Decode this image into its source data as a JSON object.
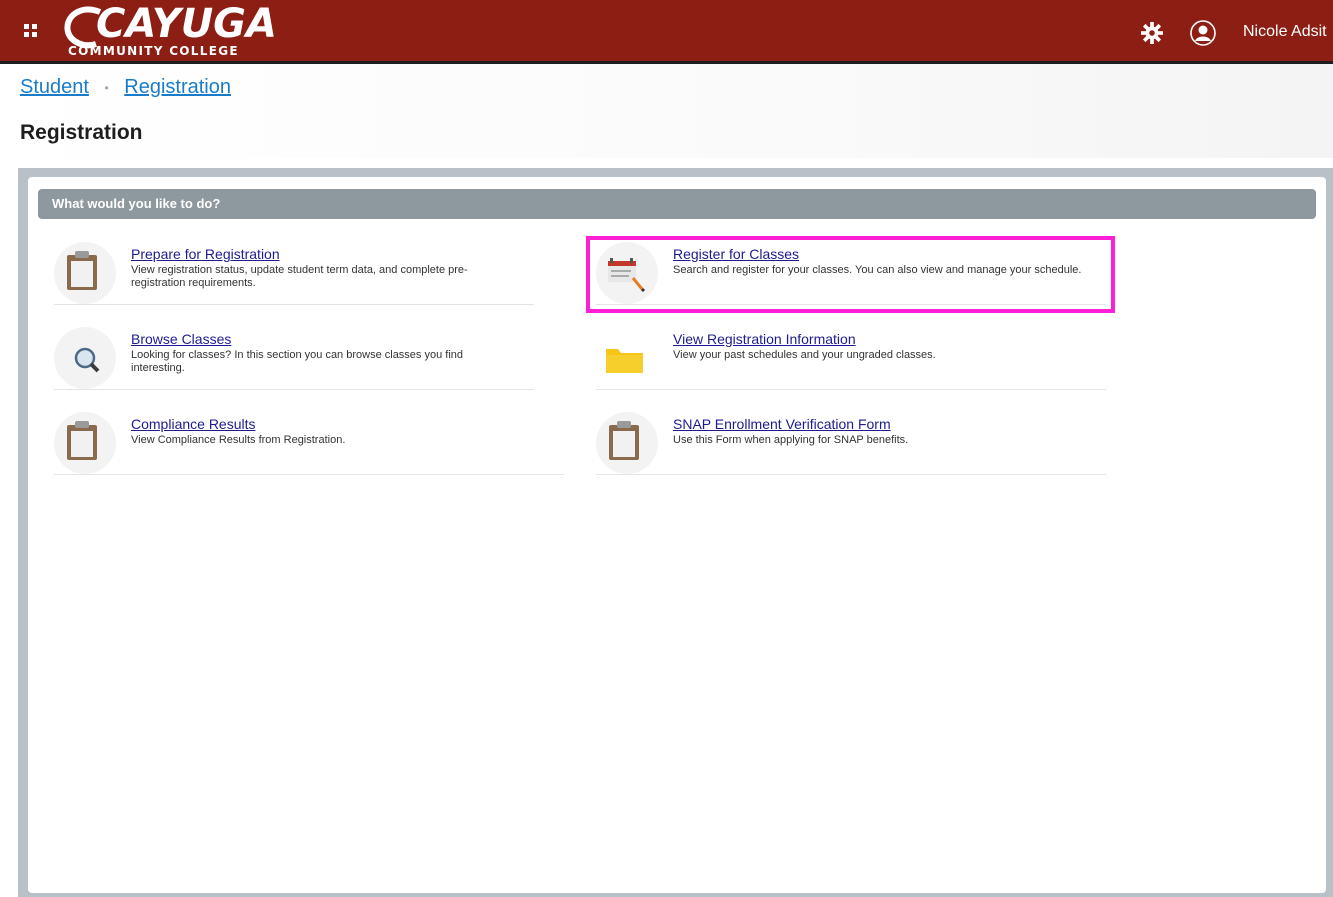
{
  "app": {
    "logo_main": "CAYUGA",
    "logo_sub": "COMMUNITY COLLEGE",
    "user_name": "Nicole Adsit"
  },
  "breadcrumb": {
    "items": [
      "Student",
      "Registration"
    ]
  },
  "page": {
    "title": "Registration"
  },
  "panel": {
    "heading": "What would you like to do?"
  },
  "actions": [
    {
      "title": "Prepare for Registration",
      "description": "View registration status, update student term data, and complete pre-registration requirements.",
      "icon": "clipboard-icon"
    },
    {
      "title": "Register for Classes",
      "description": "Search and register for your classes. You can also view and manage your schedule.",
      "icon": "calendar-pencil-icon",
      "highlighted": true
    },
    {
      "title": "Browse Classes",
      "description": "Looking for classes? In this section you can browse classes you find interesting.",
      "icon": "magnifier-icon"
    },
    {
      "title": "View Registration Information",
      "description": "View your past schedules and your ungraded classes.",
      "icon": "folder-icon"
    },
    {
      "title": "Compliance Results",
      "description": "View Compliance Results from Registration.",
      "icon": "clipboard-icon"
    },
    {
      "title": "SNAP Enrollment Verification Form",
      "description": "Use this Form when applying for SNAP benefits.",
      "icon": "clipboard-icon"
    }
  ],
  "colors": {
    "header": "#8c1e14",
    "link": "#1a7cc9",
    "action_title": "#1c1c90",
    "panel_head": "#8d989f",
    "highlight": "#ff1fd4"
  }
}
